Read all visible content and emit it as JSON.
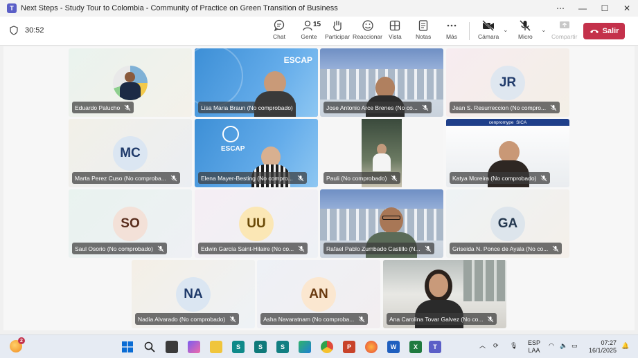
{
  "window": {
    "title": "Next Steps - Study Tour to Colombia - Community of Practice on Green Transition of Business",
    "app_icon_label": "T"
  },
  "toolbar": {
    "timer": "30:52",
    "people_count": "15",
    "buttons": {
      "chat": "Chat",
      "people": "Gente",
      "raise": "Participar",
      "react": "Reaccionar",
      "view": "Vista",
      "notes": "Notas",
      "more": "Más",
      "camera": "Cámara",
      "mic": "Micro",
      "share": "Compartir"
    },
    "leave_label": "Salir"
  },
  "participants": [
    {
      "name": "Eduardo Palucho",
      "type": "logo-photo"
    },
    {
      "name": "Lisa Maria Braun (No comprobado)",
      "type": "escap",
      "speaking": true
    },
    {
      "name": "Jose Antonio Arce Brenes (No co...",
      "type": "building"
    },
    {
      "name": "Jean S. Resurreccion (No compro...",
      "type": "initials",
      "initials": "JR"
    },
    {
      "name": "Marta Perez Cuso (No comproba...",
      "type": "initials",
      "initials": "MC"
    },
    {
      "name": "Elena Mayer-Besting (No compro...",
      "type": "escap2"
    },
    {
      "name": "Pauli (No comprobado)",
      "type": "portrait"
    },
    {
      "name": "Katya Moreira (No comprobado)",
      "type": "cenpromype"
    },
    {
      "name": "Saul Osorio (No comprobado)",
      "type": "initials",
      "initials": "SO"
    },
    {
      "name": "Edwin García Saint-Hilaire (No co...",
      "type": "initials",
      "initials": "UU"
    },
    {
      "name": "Rafael Pablo Zumbado Castillo (N...",
      "type": "building2"
    },
    {
      "name": "Griseida N. Ponce de Ayala (No co...",
      "type": "initials",
      "initials": "GA"
    },
    {
      "name": "Nadia Alvarado (No comprobado)",
      "type": "initials",
      "initials": "NA"
    },
    {
      "name": "Asha Navaratnam (No comproba...",
      "type": "initials",
      "initials": "AN"
    },
    {
      "name": "Ana Carolina Tovar Galvez (No co...",
      "type": "office"
    }
  ],
  "escap_label": "ESCAP",
  "cenpromype_label": "cenpromype",
  "sica_label": "SICA",
  "taskbar": {
    "notification_count": "2",
    "language": "ESP",
    "layout": "LAA",
    "time": "07:27",
    "date": "16/1/2025"
  },
  "colors": {
    "accent": "#5b5fc7",
    "leave": "#c4314b",
    "avatar_text": "#1f3a6a"
  }
}
